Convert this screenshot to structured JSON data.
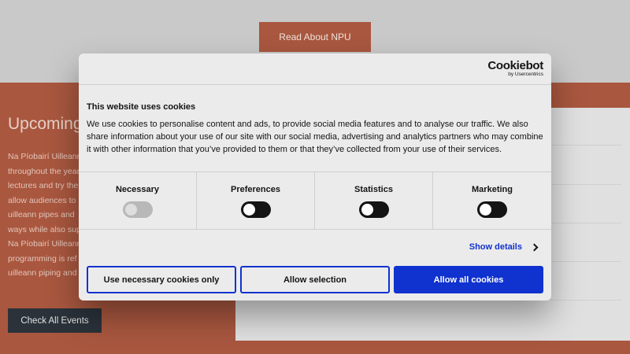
{
  "page": {
    "read_about_label": "Read About NPU",
    "events_title": "Upcoming",
    "events_lines": [
      "Na Píobairí Uilleann",
      "throughout the year",
      "lectures and try the",
      "allow audiences to",
      "uilleann pipes and",
      "ways while also sup",
      "Na Píobairí Uilleann",
      "programming is ref",
      "uilleann piping and"
    ],
    "check_events_label": "Check All Events"
  },
  "cookie_dialog": {
    "logo_name": "Cookiebot",
    "logo_sub": "by Usercentrics",
    "title": "This website uses cookies",
    "body": "We use cookies to personalise content and ads, to provide social media features and to analyse our traffic. We also share information about your use of our site with our social media, advertising and analytics partners who may combine it with other information that you’ve provided to them or that they’ve collected from your use of their services.",
    "categories": [
      {
        "label": "Necessary",
        "enabled": true,
        "locked": true
      },
      {
        "label": "Preferences",
        "enabled": false,
        "locked": false
      },
      {
        "label": "Statistics",
        "enabled": false,
        "locked": false
      },
      {
        "label": "Marketing",
        "enabled": false,
        "locked": false
      }
    ],
    "show_details_label": "Show details",
    "buttons": {
      "necessary_only": "Use necessary cookies only",
      "allow_selection": "Allow selection",
      "allow_all": "Allow all cookies"
    },
    "colors": {
      "accent": "#1032cf",
      "brand": "#a9573f"
    }
  }
}
